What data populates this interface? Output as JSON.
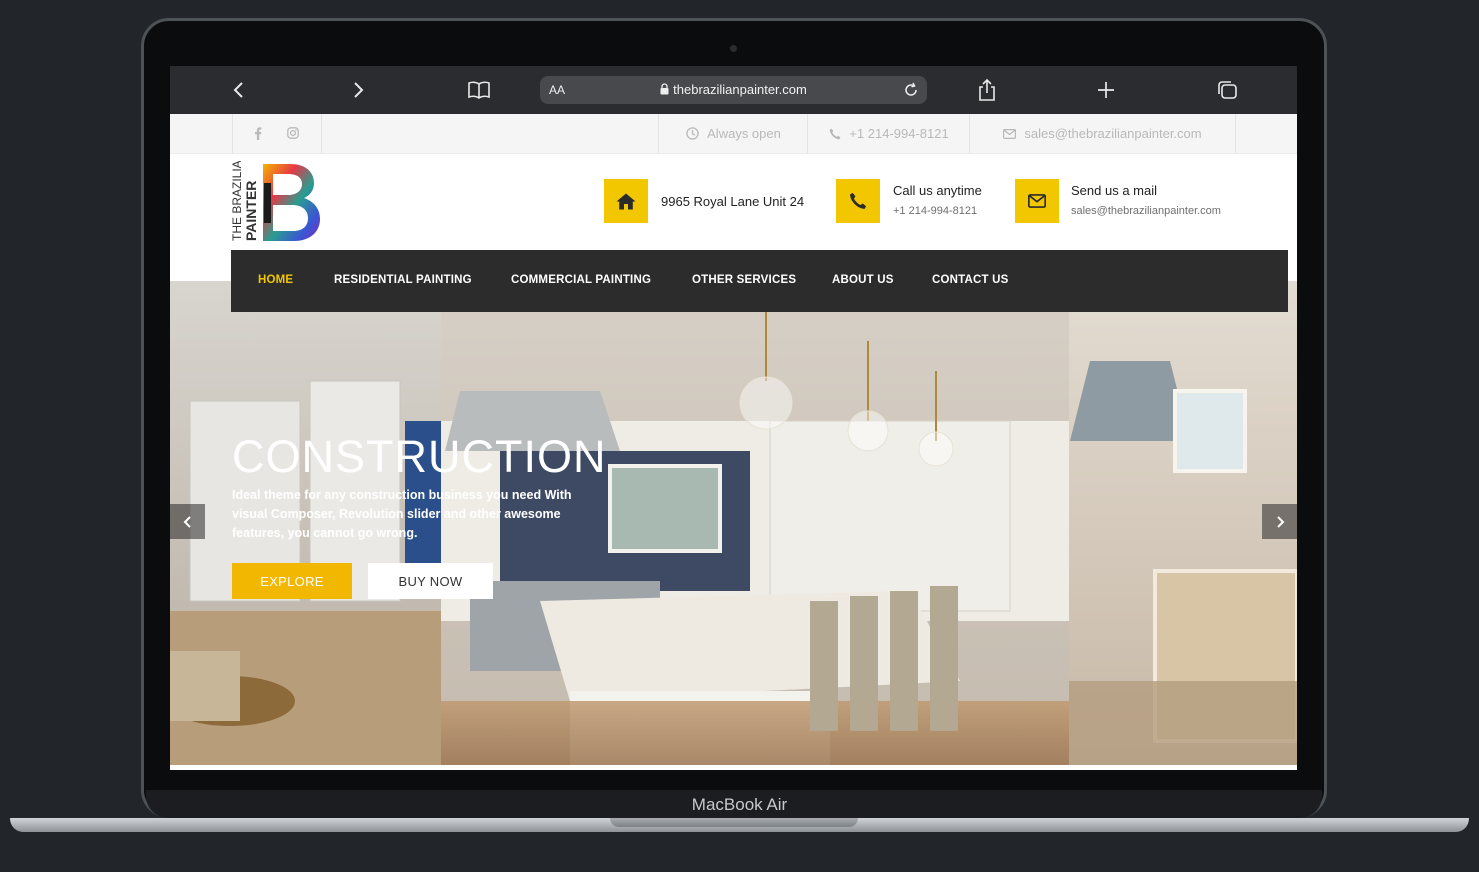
{
  "device": {
    "model_label": "MacBook Air"
  },
  "browser": {
    "text_size_label": "AA",
    "url": "thebrazilianpainter.com"
  },
  "topbar": {
    "hours": "Always open",
    "phone": "+1 214-994-8121",
    "email": "sales@thebrazilianpainter.com"
  },
  "logo": {
    "line1": "THE BRAZILIAN",
    "line2": "PAINTER"
  },
  "header": {
    "address": "9965 Royal Lane Unit 24",
    "call_title": "Call us anytime",
    "call_number": "+1 214-994-8121",
    "mail_title": "Send us a mail",
    "mail_address": "sales@thebrazilianpainter.com"
  },
  "nav": {
    "items": [
      {
        "label": "HOME"
      },
      {
        "label": "RESIDENTIAL PAINTING"
      },
      {
        "label": "COMMERCIAL PAINTING"
      },
      {
        "label": "OTHER SERVICES"
      },
      {
        "label": "ABOUT US"
      },
      {
        "label": "CONTACT US"
      }
    ],
    "active_color": "#f2c700"
  },
  "hero": {
    "title": "CONSTRUCTION",
    "description": "Ideal theme for any construction business you need With visual Composer, Revolution slider and other awesome features, you cannot go wrong.",
    "explore_label": "EXPLORE",
    "buy_label": "BUY NOW"
  },
  "icons": {
    "back": "chevron-left-icon",
    "forward": "chevron-right-icon",
    "bookmarks": "book-icon",
    "lock": "lock-icon",
    "reload": "reload-icon",
    "share": "share-icon",
    "new_tab": "plus-icon",
    "tabs": "tabs-icon",
    "facebook": "facebook-icon",
    "instagram": "instagram-icon",
    "clock": "clock-icon",
    "phone": "phone-icon",
    "mail": "mail-icon",
    "home": "home-icon"
  },
  "colors": {
    "accent": "#f2c700",
    "nav_bg": "#2c2c2c",
    "browser_bg": "#2b2c2f"
  }
}
